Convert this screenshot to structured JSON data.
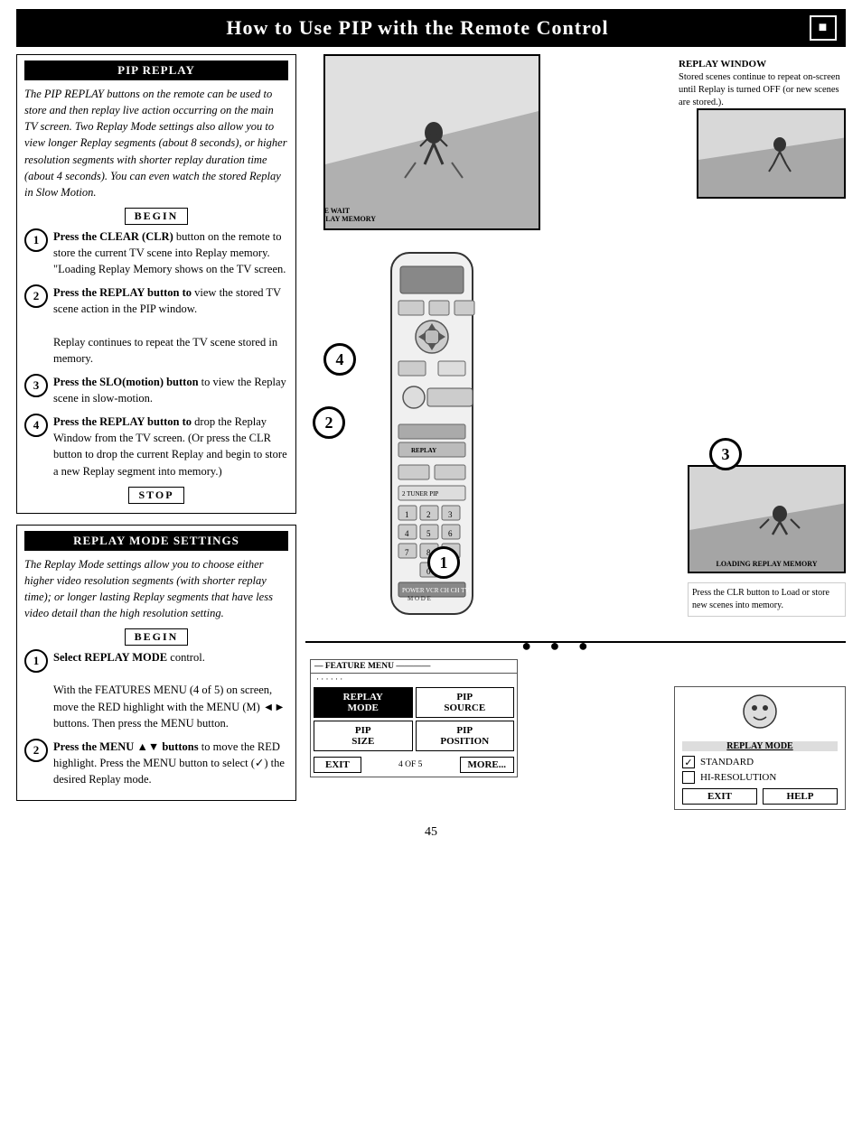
{
  "title": {
    "text": "How to Use PIP with the Remote Control",
    "box_symbol": "■"
  },
  "pip_replay_section": {
    "header": "PIP REPLAY",
    "intro": "The PIP REPLAY buttons on the remote can be used to store and then replay live action occurring on the main TV screen. Two Replay Mode settings also allow you to view longer Replay segments (about 8 seconds), or higher resolution segments with shorter replay duration time (about 4 seconds). You can even watch the stored Replay in Slow Motion.",
    "begin_label": "BEGIN",
    "stop_label": "STOP",
    "steps": [
      {
        "num": "1",
        "bold_part": "Press the CLEAR (CLR)",
        "rest": " button on the remote to store the current TV scene into Replay memory. \"Loading Replay Memory shows on the TV screen."
      },
      {
        "num": "2",
        "bold_part": "Press the REPLAY button to",
        "rest": " view the stored TV scene action in the PIP window.\n\nReplay continues to repeat the TV scene stored in memory."
      },
      {
        "num": "3",
        "bold_part": "Press the SLO(motion) button",
        "rest": " to view the Replay scene in slow-motion."
      },
      {
        "num": "4",
        "bold_part": "Press the REPLAY button to",
        "rest": " drop the Replay Window from the TV screen. (Or press the CLR button to drop the current Replay and begin to store a new Replay segment into memory.)"
      }
    ]
  },
  "replay_mode_settings": {
    "header": "REPLAY MODE SETTINGS",
    "intro": "The Replay Mode settings allow you to choose either higher video resolution segments (with shorter replay time); or longer lasting Replay segments that have less video detail than the high resolution setting.",
    "begin_label": "BEGIN",
    "steps": [
      {
        "num": "1",
        "bold_part": "Select REPLAY MODE",
        "rest": " control.\n\nWith the FEATURES MENU (4 of 5) on screen, move the RED highlight with the MENU (M) ◄► buttons. Then press the MENU button."
      },
      {
        "num": "2",
        "bold_part": "Press the MENU ▲▼ buttons",
        "rest": " to move the RED highlight. Press the MENU button to select (✓) the desired Replay mode."
      }
    ]
  },
  "annotations": {
    "please_wait": "PLEASE WAIT\nLOADING REPLAY MEMORY",
    "replay_window_title": "REPLAY WINDOW",
    "replay_window_text": "Stored scenes continue to repeat on-screen until Replay is turned OFF (or new scenes are stored.).",
    "loading_replay_memory": "LOADING REPLAY MEMORY",
    "clr_note": "Press the CLR button to\nLoad or store new scenes\ninto memory."
  },
  "feature_menu": {
    "title": "— FEATURE MENU ————",
    "dots": "· · · · · ·",
    "cells": [
      {
        "label": "REPLAY\nMODE",
        "highlighted": true
      },
      {
        "label": "PIP\nSOURCE",
        "highlighted": false
      },
      {
        "label": "PIP\nSIZE",
        "highlighted": false
      },
      {
        "label": "PIP\nPOSITION",
        "highlighted": false
      }
    ],
    "exit_label": "EXIT",
    "more_label": "MORE...",
    "count": "4 OF 5"
  },
  "replay_mode_panel": {
    "title": "REPLAY MODE",
    "options": [
      {
        "label": "STANDARD",
        "checked": true
      },
      {
        "label": "HI-RESOLUTION",
        "checked": false
      }
    ],
    "buttons": [
      {
        "label": "EXIT"
      },
      {
        "label": "HELP"
      }
    ]
  },
  "page_number": "45",
  "remote_badges": [
    "4",
    "2",
    "3",
    "1"
  ]
}
